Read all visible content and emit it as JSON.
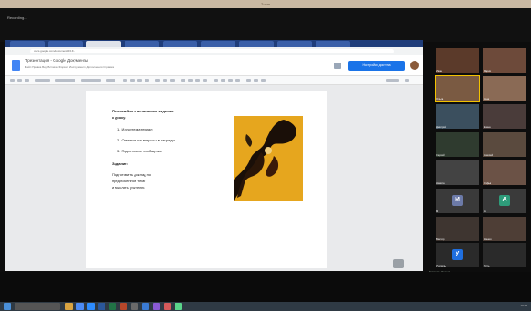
{
  "window": {
    "title": "Zoom"
  },
  "recording_label": "Recording...",
  "browser": {
    "url": "docs.google.com/document/d/1K...",
    "doc_title": "Презентация - Google Документы",
    "menu": "Файл  Правка  Вид  Вставка  Формат  Инструменты  Дополнения  Справка",
    "share_label": "Настройки доступа"
  },
  "document": {
    "lines": [
      "Прочитайте и выполните задания",
      "к уроку:",
      "1. Изучите материал",
      "2. Ответьте на вопросы в тетради",
      "3. Подготовьте сообщение",
      "Задание:",
      "Подготовить доклад по",
      "предложенной теме",
      "и выслать учителю."
    ]
  },
  "participants": [
    {
      "name": "Иван",
      "color": "#5b3a2a"
    },
    {
      "name": "Мария",
      "color": "#6d4a3a"
    },
    {
      "name": "Ольга",
      "color": "#7a5a42"
    },
    {
      "name": "Анна",
      "color": "#8a6a55"
    },
    {
      "name": "Дмитрий",
      "color": "#3b4f5e"
    },
    {
      "name": "Елена",
      "color": "#4a3c3a"
    },
    {
      "name": "Сергей",
      "color": "#2f3b2f"
    },
    {
      "name": "Алексей",
      "color": "#5a4a3e"
    },
    {
      "name": "Никита",
      "color": "#434343"
    },
    {
      "name": "Софья",
      "color": "#6b5246"
    },
    {
      "name": "M",
      "color": "#3a3a3a",
      "letter": "M",
      "letter_color": "#6c7aa8"
    },
    {
      "name": "A",
      "color": "#3a3a3a",
      "letter": "A",
      "letter_color": "#2e9c7a"
    },
    {
      "name": "Виктор",
      "color": "#3e3530"
    },
    {
      "name": "Ксения",
      "color": "#4e3e36"
    },
    {
      "name": "Учитель",
      "color": "#1f6fe0",
      "letter": "У",
      "letter_color": "#1f6fe0"
    },
    {
      "name": "Гость",
      "color": "#2a2a2a"
    }
  ],
  "speaker_label": "Говорит: Учитель",
  "tray_time": "10:25"
}
